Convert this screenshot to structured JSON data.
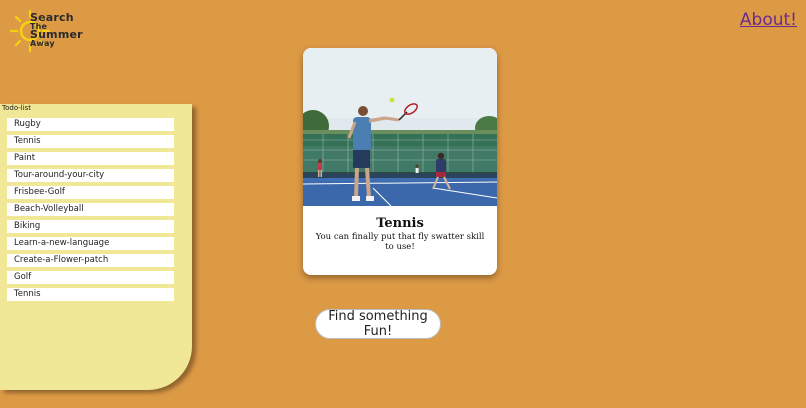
{
  "logo": {
    "lines": [
      "Search",
      "The",
      "Summer",
      "Away"
    ],
    "icon": "sun-icon"
  },
  "nav": {
    "about_label": "About!"
  },
  "todo": {
    "title": "Todo-list",
    "items": [
      "Rugby",
      "Tennis",
      "Paint",
      "Tour-around-your-city",
      "Frisbee-Golf",
      "Beach-Volleyball",
      "Biking",
      "Learn-a-new-language",
      "Create-a-Flower-patch",
      "Golf",
      "Tennis"
    ]
  },
  "card": {
    "image": "tennis-players-photo",
    "title": "Tennis",
    "description": "You can finally put that fly swatter skill to use!"
  },
  "actions": {
    "find_label": "Find something Fun!"
  },
  "colors": {
    "background": "#dd9a45",
    "sidebar": "#f0e896",
    "link": "#6a2b8f",
    "sun": "#f5d20f"
  }
}
